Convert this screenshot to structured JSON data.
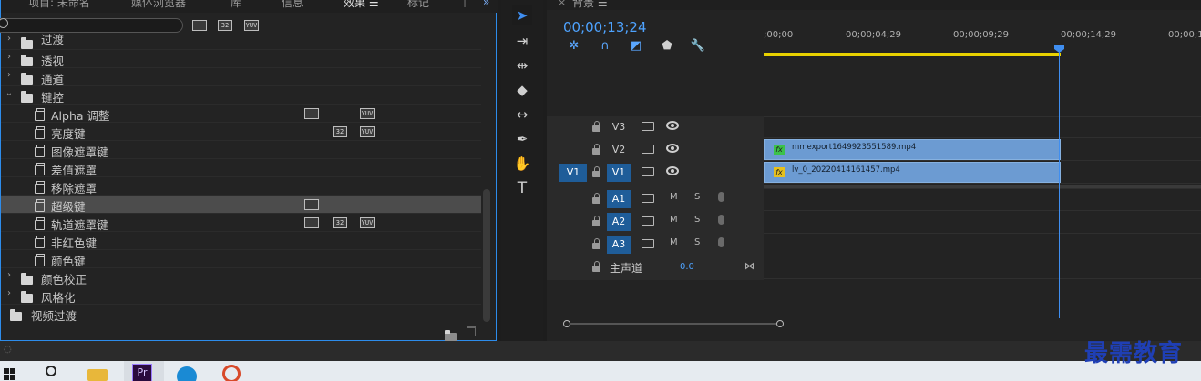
{
  "effects_panel": {
    "tabs": [
      "项目: 未命名",
      "媒体浏览器",
      "库",
      "信息",
      "效果 ☰",
      "标记"
    ],
    "items": [
      {
        "label": "过渡",
        "kind": "folder",
        "expanded": false,
        "badges": []
      },
      {
        "label": "透视",
        "kind": "folder",
        "expanded": false,
        "badges": []
      },
      {
        "label": "通道",
        "kind": "folder",
        "expanded": false,
        "badges": []
      },
      {
        "label": "键控",
        "kind": "folder",
        "expanded": true,
        "badges": []
      },
      {
        "label": "Alpha 调整",
        "kind": "preset",
        "badges": [
          "accel",
          "",
          "yuv"
        ]
      },
      {
        "label": "亮度键",
        "kind": "preset",
        "badges": [
          "",
          "32",
          "yuv"
        ]
      },
      {
        "label": "图像遮罩键",
        "kind": "preset",
        "badges": []
      },
      {
        "label": "差值遮罩",
        "kind": "preset",
        "badges": []
      },
      {
        "label": "移除遮罩",
        "kind": "preset",
        "badges": []
      },
      {
        "label": "超级键",
        "kind": "preset",
        "selected": true,
        "badges": [
          "accel",
          "",
          ""
        ]
      },
      {
        "label": "轨道遮罩键",
        "kind": "preset",
        "badges": [
          "accel",
          "32",
          "yuv"
        ]
      },
      {
        "label": "非红色键",
        "kind": "preset",
        "badges": []
      },
      {
        "label": "颜色键",
        "kind": "preset",
        "badges": []
      },
      {
        "label": "颜色校正",
        "kind": "folder",
        "expanded": false,
        "badges": []
      },
      {
        "label": "风格化",
        "kind": "folder",
        "expanded": false,
        "badges": []
      },
      {
        "label": "视频过渡",
        "kind": "folder-root",
        "badges": []
      }
    ],
    "filter_badges": [
      "accel",
      "32",
      "YUV"
    ]
  },
  "timeline": {
    "tab_label": "背景 ☰",
    "timecode": "00;00;13;24",
    "ruler_labels": [
      ";00;00",
      "00;00;04;29",
      "00;00;09;29",
      "00;00;14;29",
      "00;00;1"
    ],
    "video_tracks": [
      {
        "name": "V3",
        "clip": null
      },
      {
        "name": "V2",
        "clip": {
          "name": "mmexport1649923551589.mp4",
          "badge": "fx",
          "badge_color": "#3cc24a"
        }
      },
      {
        "name": "V1",
        "source": "V1",
        "clip": {
          "name": "lv_0_20220414161457.mp4",
          "badge": "fx",
          "badge_color": "#e6c01d"
        }
      }
    ],
    "audio_tracks": [
      {
        "name": "A1",
        "m": "M",
        "s": "S"
      },
      {
        "name": "A2",
        "m": "M",
        "s": "S"
      },
      {
        "name": "A3",
        "m": "M",
        "s": "S"
      }
    ],
    "master": {
      "label": "主声道",
      "value": "0.0"
    }
  },
  "watermark": "最需教育",
  "colors": {
    "accent": "#2d8ceb",
    "playhead": "#3f8ef0",
    "clip": "#6c9bd2",
    "workarea": "#e8d100"
  }
}
